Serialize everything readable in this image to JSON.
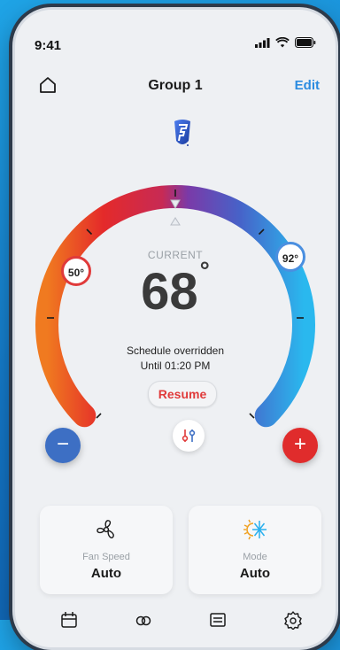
{
  "status": {
    "time": "9:41"
  },
  "header": {
    "title": "Group 1",
    "edit_label": "Edit"
  },
  "thermostat": {
    "current_label": "CURRENT",
    "current_temp": "68",
    "degree_symbol": "°",
    "heat_setpoint": "50°",
    "cool_setpoint": "92°",
    "schedule_text": "Schedule overridden",
    "until_text": "Until 01:20 PM",
    "resume_label": "Resume"
  },
  "controls": {
    "minus_label": "−",
    "plus_label": "+"
  },
  "cards": {
    "fan": {
      "label": "Fan Speed",
      "value": "Auto",
      "icon": "fan-icon"
    },
    "mode": {
      "label": "Mode",
      "value": "Auto",
      "icon": "heat-cool-icon"
    }
  },
  "tab_bar": {
    "icons": [
      "calendar-icon",
      "link-icon",
      "list-icon",
      "gear-icon"
    ]
  },
  "colors": {
    "heat": "#e03a3a",
    "cool": "#4a8fe0",
    "edit": "#2b8be0",
    "resume": "#e03a3a"
  }
}
